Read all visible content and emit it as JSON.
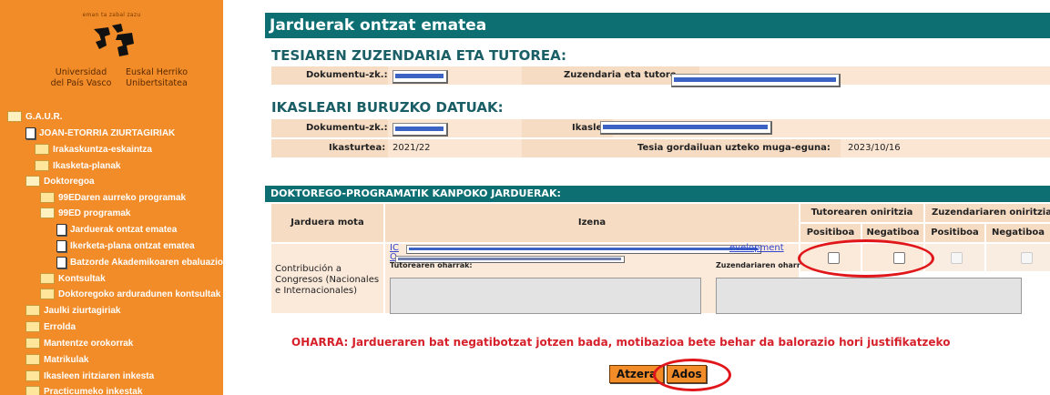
{
  "sidebar": {
    "logo_top_text": "eman ta zabal zazu",
    "logo_left": [
      "Universidad",
      "del País Vasco"
    ],
    "logo_right": [
      "Euskal Herriko",
      "Unibertsitatea"
    ],
    "items": [
      {
        "label": "G.A.U.R.",
        "icon": "folder-open-icon"
      },
      {
        "label": "JOAN-ETORRIA ZIURTAGIRIAK",
        "icon": "document-icon"
      },
      {
        "label": "Irakaskuntza-eskaintza",
        "icon": "folder-icon"
      },
      {
        "label": "Ikasketa-planak",
        "icon": "folder-icon"
      },
      {
        "label": "Doktoregoa",
        "icon": "folder-open-icon"
      },
      {
        "label": "99EDaren aurreko programak",
        "icon": "folder-icon"
      },
      {
        "label": "99ED programak",
        "icon": "folder-open-icon"
      },
      {
        "label": "Jarduerak ontzat ematea",
        "icon": "document-icon"
      },
      {
        "label": "Ikerketa-plana ontzat ematea",
        "icon": "document-icon"
      },
      {
        "label": "Batzorde Akademikoaren ebaluazioa",
        "icon": "document-icon"
      },
      {
        "label": "Kontsultak",
        "icon": "folder-icon"
      },
      {
        "label": "Doktoregoko arduradunen kontsultak",
        "icon": "folder-icon"
      },
      {
        "label": "Jaulki ziurtagiriak",
        "icon": "folder-icon"
      },
      {
        "label": "Errolda",
        "icon": "folder-icon"
      },
      {
        "label": "Mantentze orokorrak",
        "icon": "folder-icon"
      },
      {
        "label": "Matrikulak",
        "icon": "folder-icon"
      },
      {
        "label": "Ikasleen iritziaren inkesta",
        "icon": "folder-icon"
      },
      {
        "label": "Practicumeko inkestak",
        "icon": "folder-icon"
      }
    ]
  },
  "main": {
    "title": "Jarduerak ontzat ematea",
    "section1_title": "TESIAREN ZUZENDARIA ETA TUTOREA:",
    "s1_doc_label": "Dokumentu-zk.:",
    "s1_director_label": "Zuzendaria eta tutore",
    "section2_title": "IKASLEARI BURUZKO DATUAK:",
    "s2_doc_label": "Dokumentu-zk.:",
    "s2_student_label": "Ikaslea:",
    "year_label": "Ikasturtea:",
    "year_value": "2021/22",
    "deadline_label": "Tesia gordailuan uzteko muga-eguna:",
    "deadline_value": "2023/10/16",
    "section3_title": "DOKTOREGO-PROGRAMATIK KANPOKO JARDUERAK:",
    "table": {
      "col_type": "Jarduera mota",
      "col_name": "Izena",
      "col_tutor": "Tutorearen oniritzia",
      "col_director": "Zuzendariaren oniritzia",
      "positive": "Positiboa",
      "negative": "Negatiboa",
      "row_type": "Contribución a Congresos (Nacionales e Internacionales)",
      "row_link_prefix1": "IC",
      "row_link_suffix1": "evelopment",
      "row_link_prefix2": "O",
      "tutor_notes_label": "Tutorearen oharrak:",
      "director_notes_label": "Zuzendariaren oharrak:"
    },
    "note": "OHARRA: Jardueraren bat negatibotzat jotzen bada, motibazioa bete behar da balorazio hori justifikatzeko",
    "back_button": "Atzera",
    "ok_button": "Ados"
  },
  "colors": {
    "sidebar": "#f28c28",
    "header": "#0e6f73",
    "section_text": "#1a5e66",
    "annotation": "#e0161b",
    "note": "#d6202a"
  }
}
